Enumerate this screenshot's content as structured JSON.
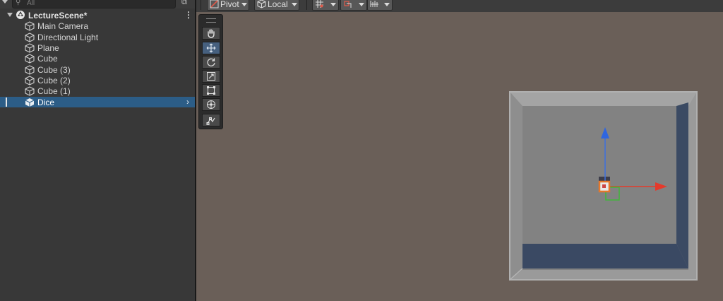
{
  "hierarchy": {
    "search_placeholder": "All",
    "scene_name": "LectureScene*",
    "objects": [
      {
        "label": "Main Camera"
      },
      {
        "label": "Directional Light"
      },
      {
        "label": "Plane"
      },
      {
        "label": "Cube"
      },
      {
        "label": "Cube (3)"
      },
      {
        "label": "Cube (2)"
      },
      {
        "label": "Cube (1)"
      },
      {
        "label": "Dice",
        "selected": true
      }
    ]
  },
  "scene_toolbar": {
    "pivot_label": "Pivot",
    "local_label": "Local"
  },
  "tools": [
    "hand-tool",
    "move-tool",
    "rotate-tool",
    "scale-tool",
    "rect-tool",
    "transform-tool",
    "custom-tool"
  ],
  "colors": {
    "selection": "#2c5d87",
    "scene_background": "#6a5f58",
    "gizmo_x": "#e53a2b",
    "gizmo_y": "#3c6fe0",
    "gizmo_z": "#3fb83a"
  }
}
